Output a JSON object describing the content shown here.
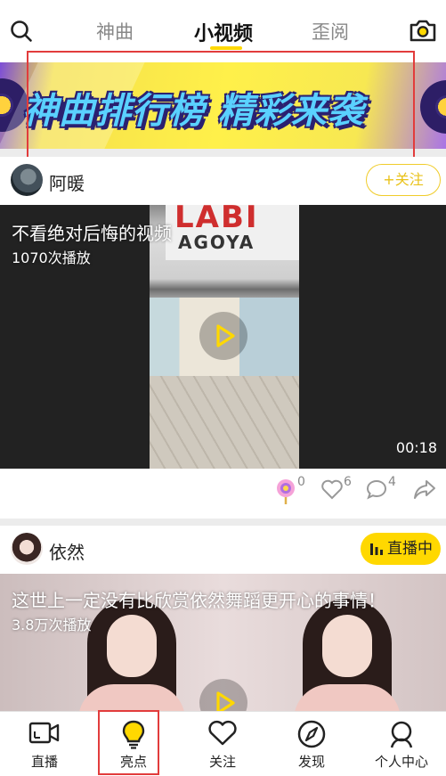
{
  "top_tabs": [
    {
      "label": "神曲"
    },
    {
      "label": "小视频"
    },
    {
      "label": "歪阅"
    }
  ],
  "active_tab": "小视频",
  "banner": {
    "title": "神曲排行榜 精彩来袭"
  },
  "colors": {
    "accent": "#ffd800",
    "highlight_box": "#e23c3c"
  },
  "feed": [
    {
      "user": "阿暖",
      "follow_label": "+关注",
      "title": "不看绝对后悔的视频",
      "plays": "1070次播放",
      "duration": "00:18",
      "video_sign_line1": "LABI",
      "video_sign_line2": "AGOYA",
      "gift_count": "0",
      "like_count": "6",
      "comment_count": "4"
    },
    {
      "user": "依然",
      "live_label": "直播中",
      "title": "这世上一定没有比欣赏依然舞蹈更开心的事情！",
      "plays": "3.8万次播放"
    }
  ],
  "bottom_nav": [
    {
      "label": "直播",
      "icon": "video-camera-icon"
    },
    {
      "label": "亮点",
      "icon": "lightbulb-icon"
    },
    {
      "label": "关注",
      "icon": "heart-icon"
    },
    {
      "label": "发现",
      "icon": "compass-icon"
    },
    {
      "label": "个人中心",
      "icon": "person-icon"
    }
  ],
  "bottom_nav_active": "亮点"
}
